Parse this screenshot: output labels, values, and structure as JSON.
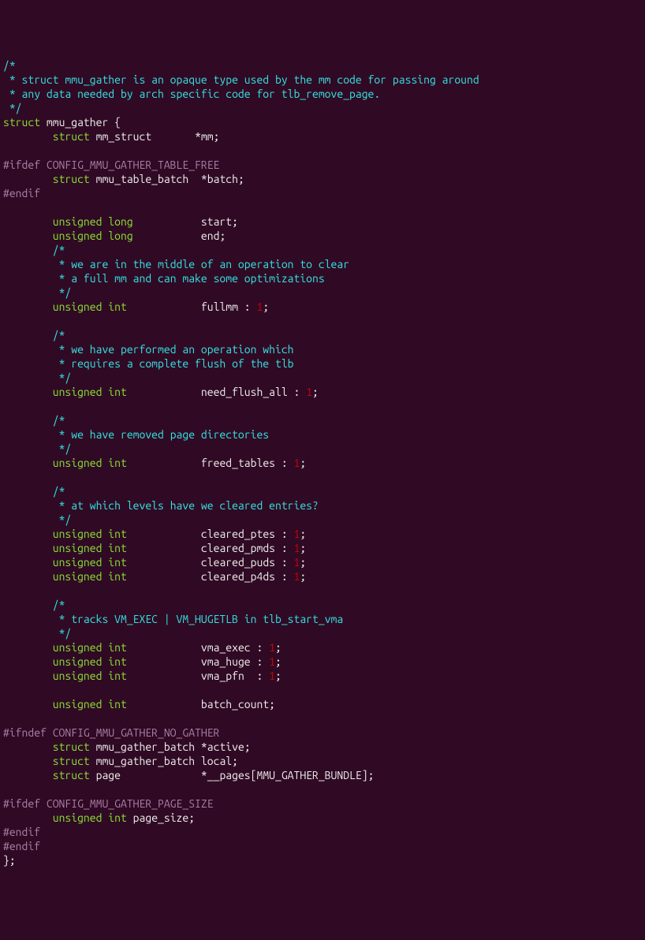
{
  "line1": "/*",
  "line2": " * struct mmu_gather is an opaque type used by the mm code for passing around",
  "line3": " * any data needed by arch specific code for tlb_remove_page.",
  "line4": " */",
  "kw_struct": "struct",
  "mmu_gather": "mmu_gather",
  "brace_open": " {",
  "mm_struct": "mm_struct",
  "mm_field": "*mm",
  "semi": ";",
  "ifdef_table_free": "#ifdef CONFIG_MMU_GATHER_TABLE_FREE",
  "mmu_table_batch": "mmu_table_batch",
  "batch_field": "*batch",
  "endif": "#endif",
  "unsigned_long": "unsigned long",
  "start_field": "start",
  "end_field": "end",
  "c_open": "/*",
  "fullmm_c1": " * we are in the middle of an operation to clear",
  "fullmm_c2": " * a full mm and can make some optimizations",
  "c_close": " */",
  "unsigned_int": "unsigned int",
  "fullmm": "fullmm : ",
  "one": "1",
  "needflush_c1": " * we have performed an operation which",
  "needflush_c2": " * requires a complete flush of the tlb",
  "need_flush_all": "need_flush_all : ",
  "freed_c1": " * we have removed page directories",
  "freed_tables": "freed_tables : ",
  "cleared_c1": " * at which levels have we cleared entries?",
  "cleared_ptes": "cleared_ptes : ",
  "cleared_pmds": "cleared_pmds : ",
  "cleared_puds": "cleared_puds : ",
  "cleared_p4ds": "cleared_p4ds : ",
  "vma_c1": " * tracks VM_EXEC | VM_HUGETLB in tlb_start_vma",
  "vma_exec": "vma_exec : ",
  "vma_huge": "vma_huge : ",
  "vma_pfn": "vma_pfn  : ",
  "batch_count": "batch_count",
  "ifndef_no_gather": "#ifndef CONFIG_MMU_GATHER_NO_GATHER",
  "mmu_gather_batch": "mmu_gather_batch",
  "active_field": "*active",
  "local_field": "local",
  "page_type": "page",
  "pages_field": "*__pages[MMU_GATHER_BUNDLE]",
  "ifdef_page_size": "#ifdef CONFIG_MMU_GATHER_PAGE_SIZE",
  "page_size_field": "page_size",
  "brace_close": "};"
}
